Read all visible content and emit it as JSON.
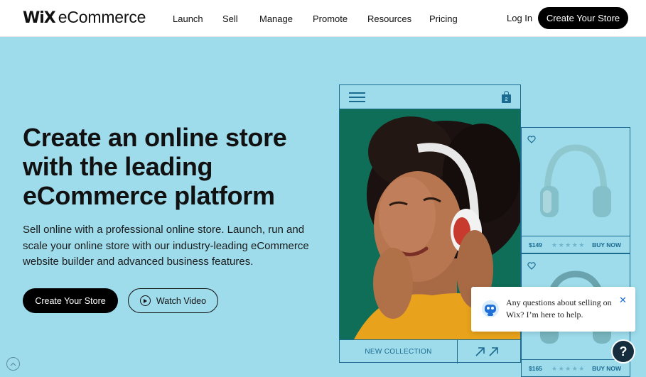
{
  "brand": {
    "logo_mark": "WiX",
    "logo_text": "eCommerce"
  },
  "nav": {
    "links": [
      "Launch",
      "Sell",
      "Manage",
      "Promote",
      "Resources",
      "Pricing"
    ],
    "login": "Log In",
    "cta": "Create Your Store"
  },
  "hero": {
    "title_lines": [
      "Create an online store",
      "with the leading",
      "eCommerce platform"
    ],
    "subtitle_lines": [
      "Sell online with a professional online store. Launch, run and",
      "scale your online store with our industry-leading eCommerce",
      "website builder and advanced business features."
    ],
    "primary_button": "Create Your Store",
    "video_button": "Watch Video"
  },
  "phone_mock": {
    "cart_count": "2",
    "collection_label": "NEW COLLECTION",
    "icons": [
      "menu-icon",
      "shopping-bag-icon",
      "arrow-up-right-icon"
    ]
  },
  "products": [
    {
      "price": "$149",
      "stars": "★★★★★",
      "action": "BUY NOW"
    },
    {
      "price": "$165",
      "stars": "★★★★★",
      "action": "BUY NOW"
    }
  ],
  "chat": {
    "message": "Any questions about selling on Wix? I’m here to help.",
    "close_icon": "close-icon",
    "help_label": "?"
  },
  "colors": {
    "background": "#9edcec",
    "accent_line": "#1b6a8f",
    "photo_bg": "#0f6e57",
    "button_dark": "#000000"
  }
}
